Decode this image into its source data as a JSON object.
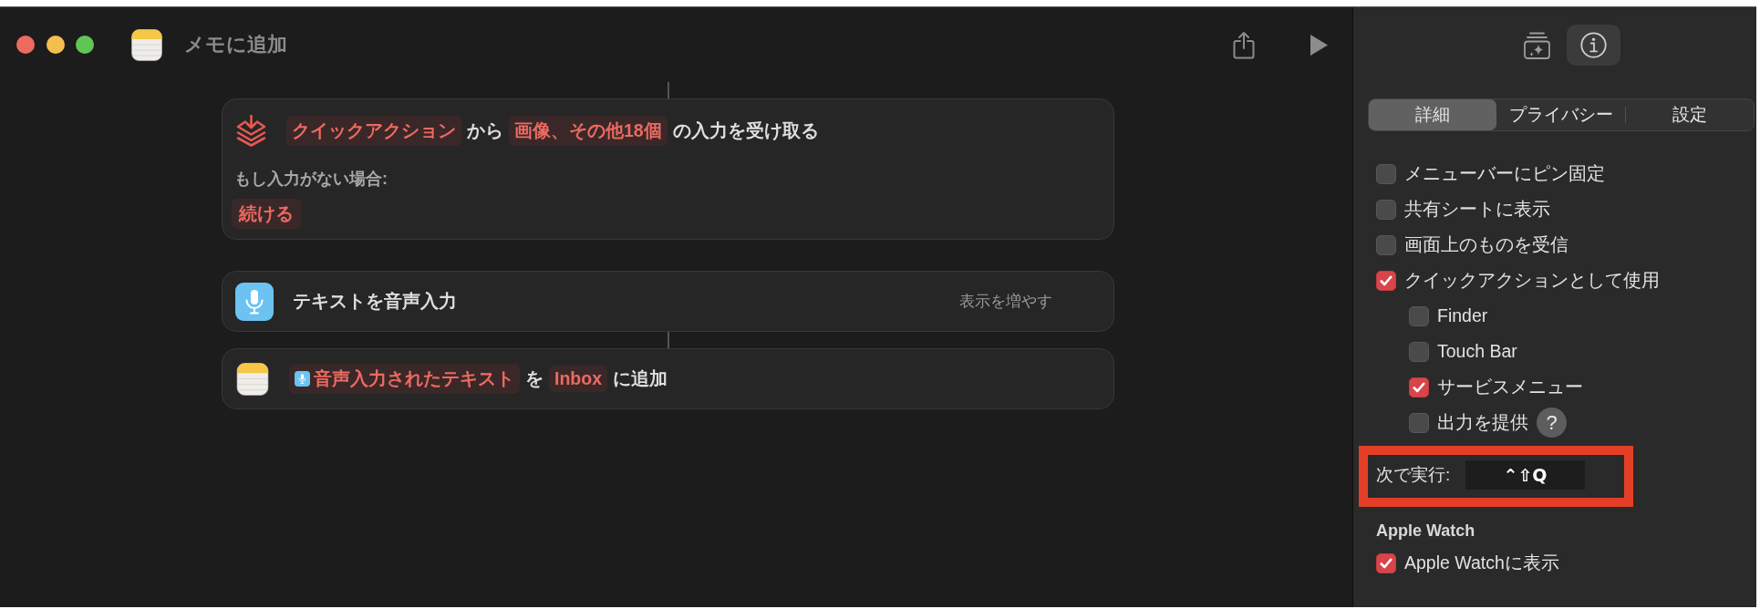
{
  "window": {
    "title": "メモに追加"
  },
  "actions": [
    {
      "kind": "receive",
      "parts": [
        {
          "kind": "token",
          "text": "クイックアクション"
        },
        {
          "kind": "plain",
          "text": "から"
        },
        {
          "kind": "token",
          "text": "画像、その他18個"
        },
        {
          "kind": "plain",
          "text": "の入力を受け取る"
        }
      ],
      "fallback": {
        "label": "もし入力がない場合:",
        "value": "続ける"
      }
    },
    {
      "kind": "dictate",
      "parts": [
        {
          "kind": "plain",
          "text": "テキストを音声入力"
        }
      ],
      "more": "表示を増やす"
    },
    {
      "kind": "notes",
      "parts": [
        {
          "kind": "variable",
          "text": "音声入力されたテキスト"
        },
        {
          "kind": "plain",
          "text": "を"
        },
        {
          "kind": "token",
          "text": "Inbox"
        },
        {
          "kind": "plain",
          "text": "に追加"
        }
      ]
    }
  ],
  "inspector": {
    "views": [
      {
        "kind": "gallery",
        "selected": false
      },
      {
        "kind": "info",
        "selected": true
      }
    ],
    "tabs": [
      {
        "label": "詳細",
        "selected": true
      },
      {
        "label": "プライバシー",
        "selected": false
      },
      {
        "label": "設定",
        "selected": false
      }
    ],
    "options": [
      {
        "label": "メニューバーにピン固定",
        "checked": false
      },
      {
        "label": "共有シートに表示",
        "checked": false
      },
      {
        "label": "画面上のものを受信",
        "checked": false
      },
      {
        "label": "クイックアクションとして使用",
        "checked": true,
        "children": [
          {
            "label": "Finder",
            "checked": false
          },
          {
            "label": "Touch Bar",
            "checked": false
          },
          {
            "label": "サービスメニュー",
            "checked": true
          },
          {
            "label": "出力を提供",
            "checked": false,
            "help": "?"
          }
        ]
      }
    ],
    "shortcut": {
      "label": "次で実行:",
      "keys": "⌃⇧Q",
      "highlighted": true
    },
    "watch": {
      "heading": "Apple Watch",
      "options": [
        {
          "label": "Apple Watchに表示",
          "checked": true
        }
      ]
    }
  }
}
